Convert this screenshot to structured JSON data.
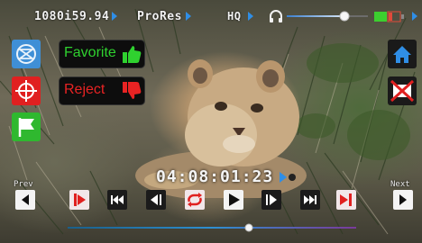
{
  "top_bar": {
    "video_format": "1080i59.94",
    "codec": "ProRes",
    "quality": "HQ",
    "volume_level": 0.72
  },
  "timecode": "04:08:01:23",
  "buttons": {
    "favorite_label": "Favorite",
    "reject_label": "Reject"
  },
  "transport": {
    "prev_label": "Prev",
    "next_label": "Next",
    "playhead_position": 0.63
  },
  "colors": {
    "accent_blue": "#2f8ee6",
    "favorite_green": "#2fd12f",
    "reject_red": "#e82323",
    "battery_green": "#3ccf2f"
  },
  "icons": [
    "timelapse-icon",
    "crosshair-icon",
    "flag-icon",
    "thumbs-up-icon",
    "thumbs-down-icon",
    "headphones-icon",
    "battery-icon",
    "home-icon",
    "no-video-icon",
    "mark-in-icon",
    "skip-back-icon",
    "step-back-icon",
    "loop-icon",
    "play-icon",
    "step-forward-icon",
    "skip-forward-icon",
    "mark-out-icon",
    "prev-icon",
    "next-icon"
  ]
}
